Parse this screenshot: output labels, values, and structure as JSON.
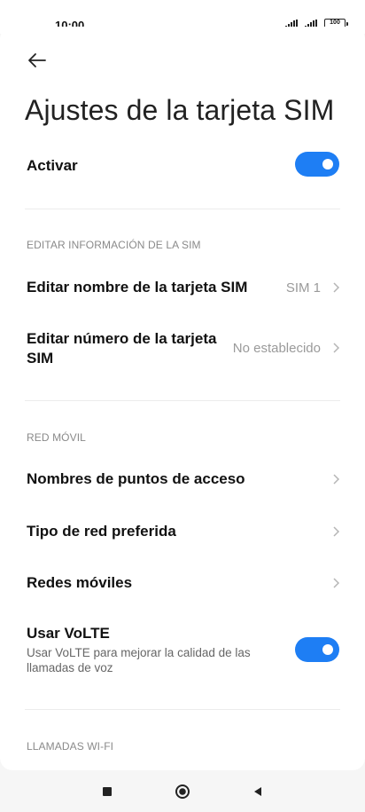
{
  "status_bar": {
    "time": "10:00",
    "battery": "100"
  },
  "header": {
    "back_icon": "arrow-left-icon",
    "title": "Ajustes de la tarjeta SIM"
  },
  "activate": {
    "label": "Activar",
    "enabled": true
  },
  "section_sim": {
    "header": "EDITAR INFORMACIÓN DE LA SIM",
    "items": [
      {
        "label": "Editar nombre de la tarjeta SIM",
        "value": "SIM 1"
      },
      {
        "label_line1": "Editar número de la tarjeta",
        "label_line2": "SIM",
        "value": "No establecido"
      }
    ]
  },
  "section_network": {
    "header": "RED MÓVIL",
    "items": [
      {
        "label": "Nombres de puntos de acceso"
      },
      {
        "label": "Tipo de red preferida"
      },
      {
        "label": "Redes móviles"
      }
    ],
    "volte": {
      "label": "Usar VoLTE",
      "description": "Usar VoLTE para mejorar la calidad de las llamadas de voz",
      "enabled": true
    }
  },
  "section_wifi": {
    "header": "LLAMADAS WI-FI"
  },
  "nav": {
    "recents_icon": "square-icon",
    "home_icon": "circle-icon",
    "back_icon": "triangle-back-icon"
  },
  "colors": {
    "accent": "#1e7ef4",
    "secondary_text": "#9a9a9a",
    "section_header": "#8a8a8a"
  }
}
